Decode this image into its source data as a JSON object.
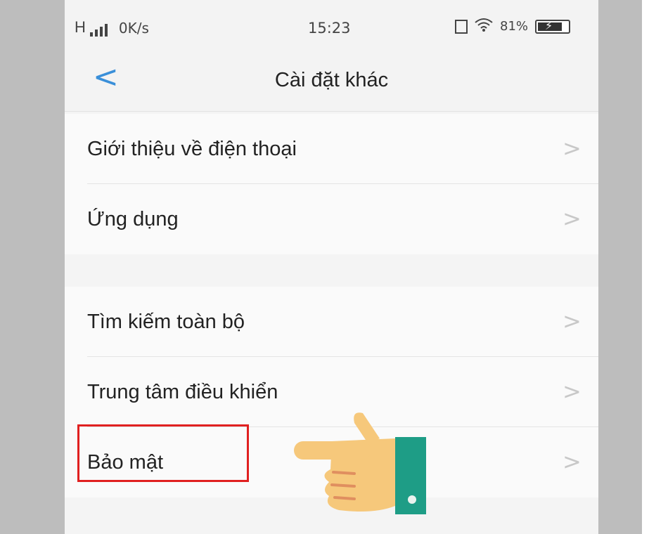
{
  "statusbar": {
    "network_type": "H",
    "speed": "0K/s",
    "time": "15:23",
    "battery": "81%"
  },
  "header": {
    "title": "Cài đặt khác"
  },
  "groups": [
    {
      "items": [
        {
          "label": "Giới thiệu về điện thoại"
        },
        {
          "label": "Ứng dụng"
        }
      ]
    },
    {
      "items": [
        {
          "label": "Tìm kiếm toàn bộ"
        },
        {
          "label": "Trung tâm điều khiển"
        },
        {
          "label": "Bảo mật"
        }
      ]
    }
  ],
  "icons": {
    "back": "chevron-left-icon",
    "row_arrow": "chevron-right-icon",
    "pointer": "pointing-hand-icon"
  },
  "colors": {
    "accent": "#3a8fd9",
    "highlight": "#e02020",
    "hand_skin": "#f6c87b",
    "cuff": "#1e9d86"
  }
}
